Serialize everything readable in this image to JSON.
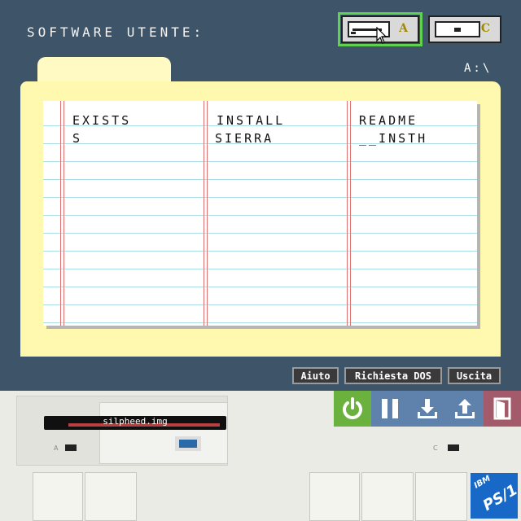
{
  "header": {
    "title": "SOFTWARE UTENTE:"
  },
  "drives": [
    {
      "letter": "A",
      "selected": true
    },
    {
      "letter": "C",
      "selected": false
    }
  ],
  "path": "A:\\",
  "files": {
    "col1": [
      "EXISTS",
      "S"
    ],
    "col2": [
      "INSTALL",
      "SIERRA"
    ],
    "col3": [
      "README",
      "__INSTH"
    ]
  },
  "buttons": {
    "help": "Aiuto",
    "dos": "Richiesta DOS",
    "exit": "Uscita"
  },
  "emulator": {
    "disk_label": "silpheed.img",
    "drive_a_label": "A",
    "drive_c_label": "C",
    "controls": [
      "power-icon",
      "pause-icon",
      "download-icon",
      "upload-icon",
      "exit-door-icon"
    ],
    "colors": {
      "power": "#6bb13d",
      "controls": "#5f82ad",
      "exit": "#a35a6a",
      "background": "#3e5468",
      "folder": "#fff9b0"
    }
  },
  "logo": {
    "brand": "IBM",
    "model": "PS/1"
  }
}
